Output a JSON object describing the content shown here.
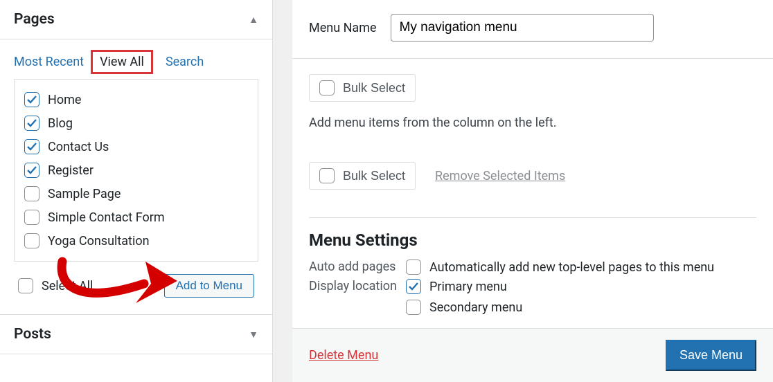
{
  "sidebar": {
    "pages_acc_title": "Pages",
    "posts_acc_title": "Posts",
    "tabs": {
      "recent": "Most Recent",
      "view_all": "View All",
      "search": "Search"
    },
    "page_items": [
      {
        "label": "Home",
        "checked": true
      },
      {
        "label": "Blog",
        "checked": true
      },
      {
        "label": "Contact Us",
        "checked": true
      },
      {
        "label": "Register",
        "checked": true
      },
      {
        "label": "Sample Page",
        "checked": false
      },
      {
        "label": "Simple Contact Form",
        "checked": false
      },
      {
        "label": "Yoga Consultation",
        "checked": false
      }
    ],
    "select_all_label": "Select All",
    "add_to_menu_label": "Add to Menu"
  },
  "main": {
    "menu_name_label": "Menu Name",
    "menu_name_value": "My navigation menu",
    "bulk_select_label": "Bulk Select",
    "help_text": "Add menu items from the column on the left.",
    "remove_selected_label": "Remove Selected Items",
    "settings_title": "Menu Settings",
    "auto_add_label": "Auto add pages",
    "auto_add_desc": "Automatically add new top-level pages to this menu",
    "display_loc_label": "Display location",
    "display_loc_options": [
      {
        "label": "Primary menu",
        "checked": true
      },
      {
        "label": "Secondary menu",
        "checked": false
      }
    ],
    "delete_menu_label": "Delete Menu",
    "save_menu_label": "Save Menu"
  }
}
